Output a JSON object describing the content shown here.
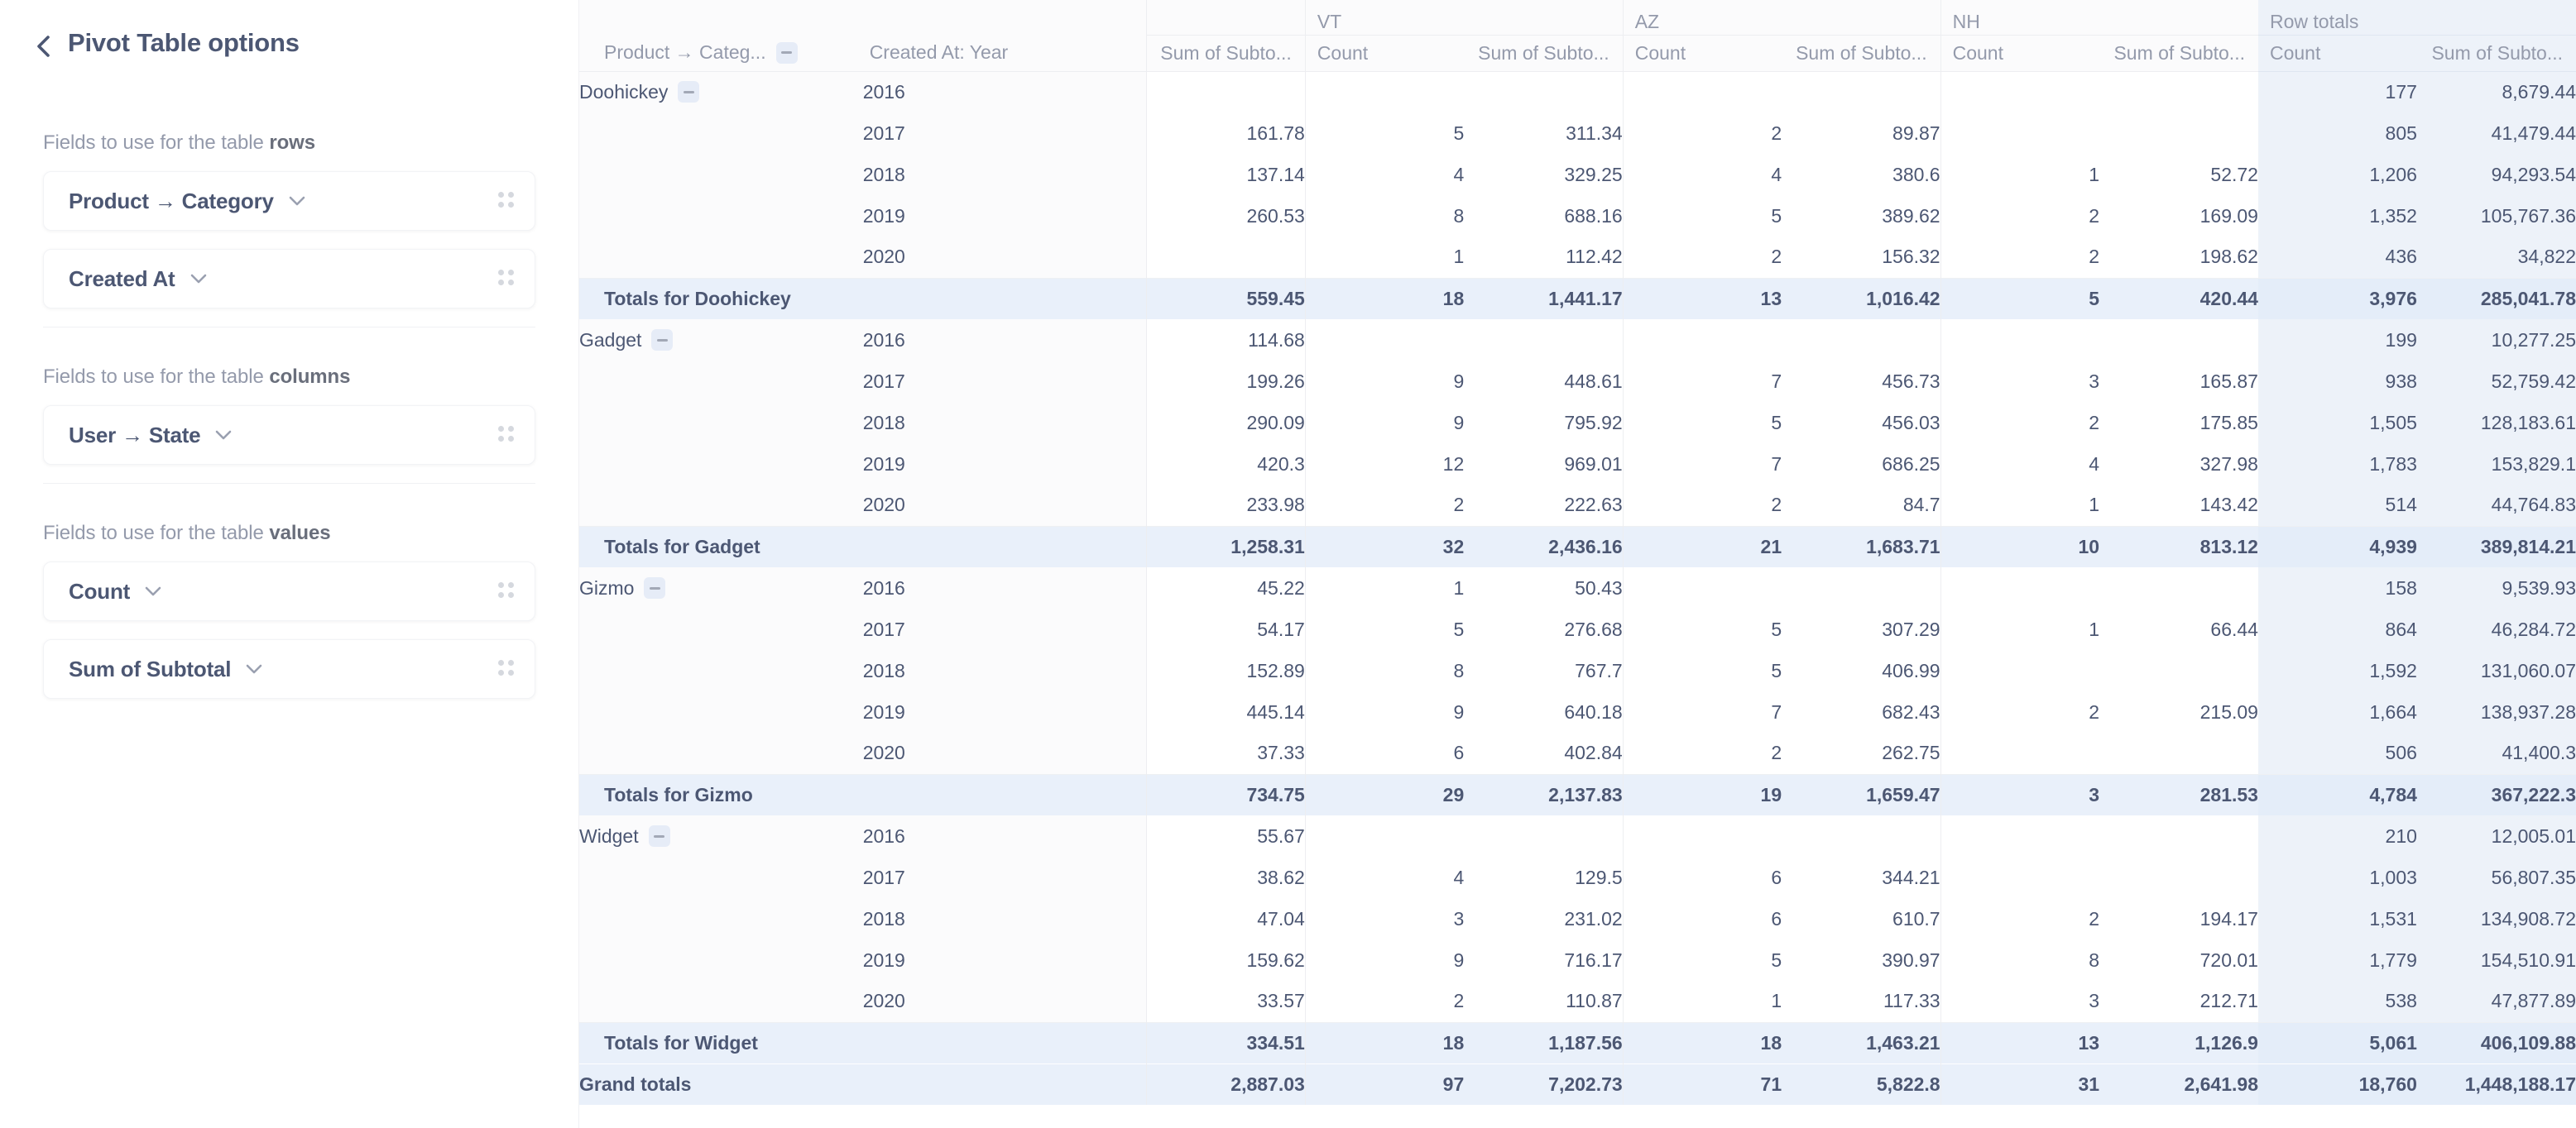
{
  "sidebar": {
    "back_icon": "chevron-left-icon",
    "title": "Pivot Table options",
    "sections": [
      {
        "key": "rows",
        "label_prefix": "Fields to use for the table ",
        "label_bold": "rows",
        "fields": [
          {
            "name": "Product → Category",
            "caret": "chevron-down-icon",
            "grip": "drag-handle-icon"
          },
          {
            "name": "Created At",
            "caret": "chevron-down-icon",
            "grip": "drag-handle-icon"
          }
        ]
      },
      {
        "key": "columns",
        "label_prefix": "Fields to use for the table ",
        "label_bold": "columns",
        "fields": [
          {
            "name": "User → State",
            "caret": "chevron-down-icon",
            "grip": "drag-handle-icon"
          }
        ]
      },
      {
        "key": "values",
        "label_prefix": "Fields to use for the table ",
        "label_bold": "values",
        "fields": [
          {
            "name": "Count",
            "caret": "chevron-down-icon",
            "grip": "drag-handle-icon"
          },
          {
            "name": "Sum of Subtotal",
            "caret": "chevron-down-icon",
            "grip": "drag-handle-icon"
          }
        ]
      }
    ]
  },
  "table": {
    "row_headers": [
      "Product → Categ...",
      "Created At: Year"
    ],
    "row_header_collapse_icon": "minus-icon",
    "column_groups": [
      {
        "label": "",
        "partial": true,
        "measures": [
          "Sum of Subto..."
        ]
      },
      {
        "label": "VT",
        "partial": false,
        "measures": [
          "Count",
          "Sum of Subto..."
        ]
      },
      {
        "label": "AZ",
        "partial": false,
        "measures": [
          "Count",
          "Sum of Subto..."
        ]
      },
      {
        "label": "NH",
        "partial": false,
        "measures": [
          "Count",
          "Sum of Subto..."
        ]
      },
      {
        "label": "Row totals",
        "partial": false,
        "measures": [
          "Count",
          "Sum of Subto..."
        ]
      }
    ],
    "groups": [
      {
        "category": "Doohickey",
        "rows": [
          {
            "year": "2016",
            "cells": [
              "",
              "",
              "",
              "",
              "",
              "",
              "",
              "177",
              "8,679.44"
            ]
          },
          {
            "year": "2017",
            "cells": [
              "161.78",
              "5",
              "311.34",
              "2",
              "89.87",
              "",
              "",
              "805",
              "41,479.44"
            ]
          },
          {
            "year": "2018",
            "cells": [
              "137.14",
              "4",
              "329.25",
              "4",
              "380.6",
              "1",
              "52.72",
              "1,206",
              "94,293.54"
            ]
          },
          {
            "year": "2019",
            "cells": [
              "260.53",
              "8",
              "688.16",
              "5",
              "389.62",
              "2",
              "169.09",
              "1,352",
              "105,767.36"
            ]
          },
          {
            "year": "2020",
            "cells": [
              "",
              "1",
              "112.42",
              "2",
              "156.32",
              "2",
              "198.62",
              "436",
              "34,822"
            ]
          }
        ],
        "totals_label": "Totals for Doohickey",
        "totals": [
          "559.45",
          "18",
          "1,441.17",
          "13",
          "1,016.42",
          "5",
          "420.44",
          "3,976",
          "285,041.78"
        ]
      },
      {
        "category": "Gadget",
        "rows": [
          {
            "year": "2016",
            "cells": [
              "114.68",
              "",
              "",
              "",
              "",
              "",
              "",
              "199",
              "10,277.25"
            ]
          },
          {
            "year": "2017",
            "cells": [
              "199.26",
              "9",
              "448.61",
              "7",
              "456.73",
              "3",
              "165.87",
              "938",
              "52,759.42"
            ]
          },
          {
            "year": "2018",
            "cells": [
              "290.09",
              "9",
              "795.92",
              "5",
              "456.03",
              "2",
              "175.85",
              "1,505",
              "128,183.61"
            ]
          },
          {
            "year": "2019",
            "cells": [
              "420.3",
              "12",
              "969.01",
              "7",
              "686.25",
              "4",
              "327.98",
              "1,783",
              "153,829.1"
            ]
          },
          {
            "year": "2020",
            "cells": [
              "233.98",
              "2",
              "222.63",
              "2",
              "84.7",
              "1",
              "143.42",
              "514",
              "44,764.83"
            ]
          }
        ],
        "totals_label": "Totals for Gadget",
        "totals": [
          "1,258.31",
          "32",
          "2,436.16",
          "21",
          "1,683.71",
          "10",
          "813.12",
          "4,939",
          "389,814.21"
        ]
      },
      {
        "category": "Gizmo",
        "rows": [
          {
            "year": "2016",
            "cells": [
              "45.22",
              "1",
              "50.43",
              "",
              "",
              "",
              "",
              "158",
              "9,539.93"
            ]
          },
          {
            "year": "2017",
            "cells": [
              "54.17",
              "5",
              "276.68",
              "5",
              "307.29",
              "1",
              "66.44",
              "864",
              "46,284.72"
            ]
          },
          {
            "year": "2018",
            "cells": [
              "152.89",
              "8",
              "767.7",
              "5",
              "406.99",
              "",
              "",
              "1,592",
              "131,060.07"
            ]
          },
          {
            "year": "2019",
            "cells": [
              "445.14",
              "9",
              "640.18",
              "7",
              "682.43",
              "2",
              "215.09",
              "1,664",
              "138,937.28"
            ]
          },
          {
            "year": "2020",
            "cells": [
              "37.33",
              "6",
              "402.84",
              "2",
              "262.75",
              "",
              "",
              "506",
              "41,400.3"
            ]
          }
        ],
        "totals_label": "Totals for Gizmo",
        "totals": [
          "734.75",
          "29",
          "2,137.83",
          "19",
          "1,659.47",
          "3",
          "281.53",
          "4,784",
          "367,222.3"
        ]
      },
      {
        "category": "Widget",
        "rows": [
          {
            "year": "2016",
            "cells": [
              "55.67",
              "",
              "",
              "",
              "",
              "",
              "",
              "210",
              "12,005.01"
            ]
          },
          {
            "year": "2017",
            "cells": [
              "38.62",
              "4",
              "129.5",
              "6",
              "344.21",
              "",
              "",
              "1,003",
              "56,807.35"
            ]
          },
          {
            "year": "2018",
            "cells": [
              "47.04",
              "3",
              "231.02",
              "6",
              "610.7",
              "2",
              "194.17",
              "1,531",
              "134,908.72"
            ]
          },
          {
            "year": "2019",
            "cells": [
              "159.62",
              "9",
              "716.17",
              "5",
              "390.97",
              "8",
              "720.01",
              "1,779",
              "154,510.91"
            ]
          },
          {
            "year": "2020",
            "cells": [
              "33.57",
              "2",
              "110.87",
              "1",
              "117.33",
              "3",
              "212.71",
              "538",
              "47,877.89"
            ]
          }
        ],
        "totals_label": "Totals for Widget",
        "totals": [
          "334.51",
          "18",
          "1,187.56",
          "18",
          "1,463.21",
          "13",
          "1,126.9",
          "5,061",
          "406,109.88"
        ]
      }
    ],
    "grand_label": "Grand totals",
    "grand_totals": [
      "2,887.03",
      "97",
      "7,202.73",
      "71",
      "5,822.8",
      "31",
      "2,641.98",
      "18,760",
      "1,448,188.17"
    ]
  },
  "colors": {
    "text_primary": "#4c5773",
    "text_muted": "#949aab",
    "total_row_bg": "#e9f0fa",
    "row_totals_bg": "#edf2f9",
    "header_bg": "#fbfbfc",
    "border": "#edeef1"
  }
}
